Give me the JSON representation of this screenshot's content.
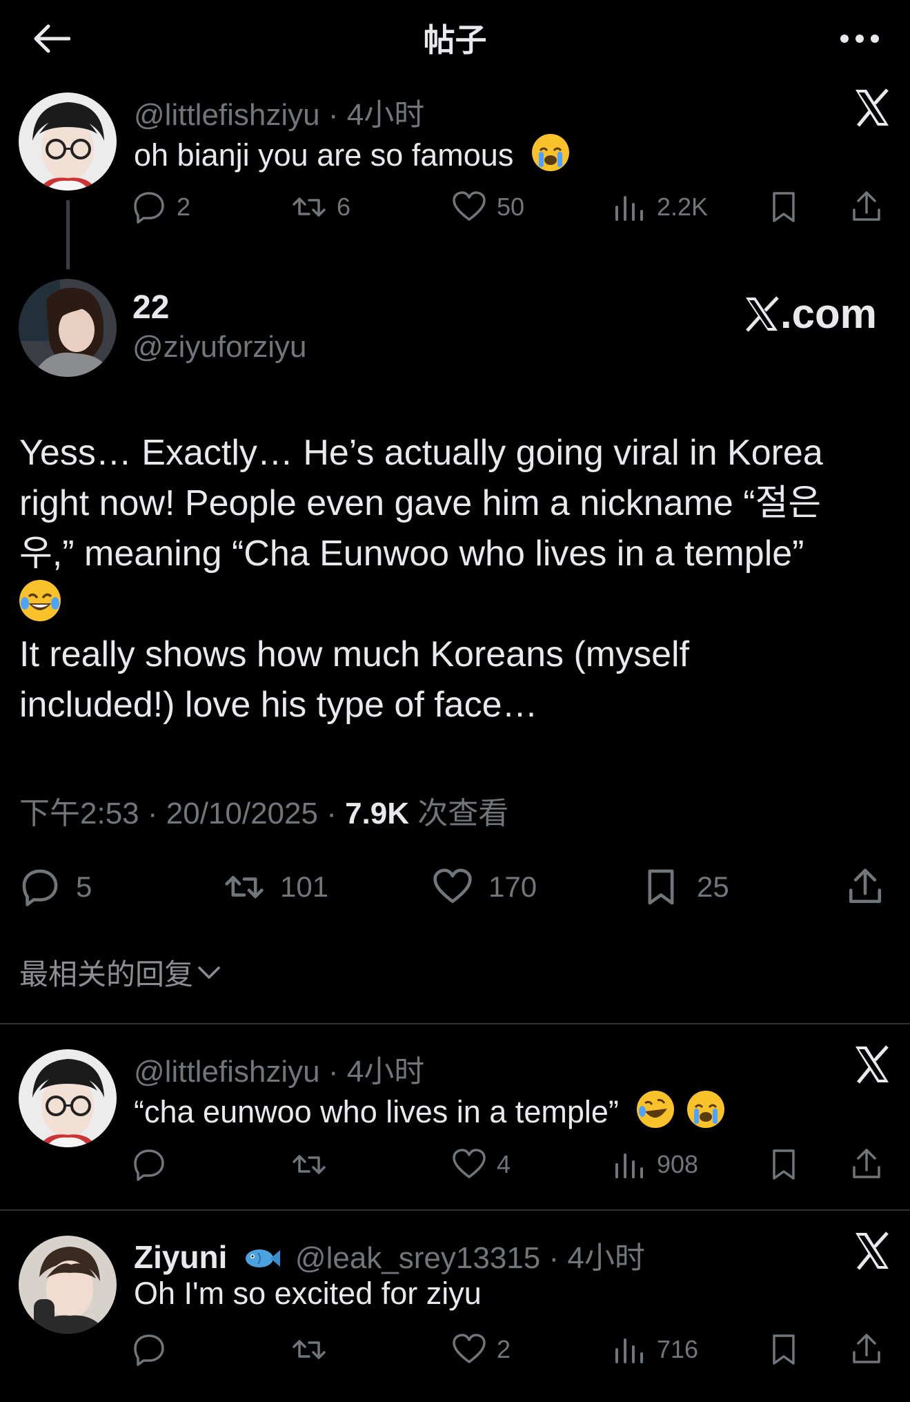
{
  "header": {
    "title": "帖子"
  },
  "thread_parent": {
    "handle": "@littlefishziyu",
    "time": "4小时",
    "text": "oh bianji you are so famous",
    "replies": "2",
    "retweets": "6",
    "likes": "50",
    "views": "2.2K"
  },
  "post": {
    "name": "22",
    "handle": "@ziyuforziyu",
    "watermark": ".com",
    "lines": [
      "Yess… Exactly… He’s actually going viral in Korea",
      "right now! People even gave him a nickname “절은",
      "우,” meaning “Cha Eunwoo who lives in a temple”",
      "It really shows how much Koreans (myself",
      "included!) love his type of face…"
    ],
    "time": "下午2:53",
    "date": "20/10/2025",
    "views": "7.9K",
    "views_label": "次查看",
    "replies": "5",
    "retweets": "101",
    "likes": "170",
    "bookmarks": "25"
  },
  "sort_label": "最相关的回复",
  "replies": [
    {
      "handle": "@littlefishziyu",
      "time": "4小时",
      "text": "“cha eunwoo who lives in a temple”",
      "replies": "",
      "retweets": "",
      "likes": "4",
      "views": "908"
    },
    {
      "name": "Ziyuni",
      "handle": "@leak_srey13315",
      "time": "4小时",
      "text": "Oh I'm so excited for ziyu",
      "replies": "",
      "retweets": "",
      "likes": "2",
      "views": "716"
    }
  ],
  "colors": {
    "background": "#000000",
    "text": "#e7e9ea",
    "secondary": "#71767b",
    "divider": "#2f3336"
  }
}
